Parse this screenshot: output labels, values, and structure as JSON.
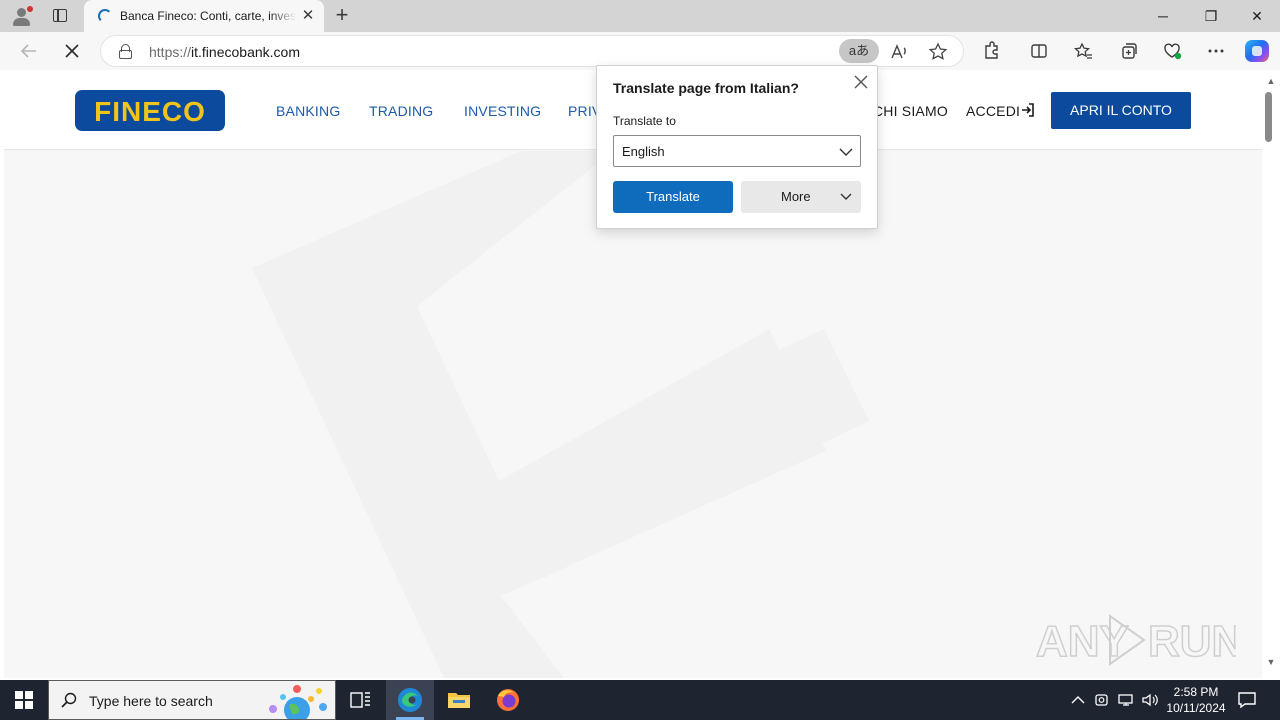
{
  "browser": {
    "tab_title": "Banca Fineco: Conti, carte, investimenti",
    "tab_close": "✕",
    "new_tab": "+",
    "url_scheme": "https://",
    "url_host": "it.finecobank.com",
    "translate_pill": "aあ",
    "window_controls": {
      "minimize": "─",
      "maximize": "❐",
      "close": "✕"
    }
  },
  "site": {
    "logo": "FINECO",
    "nav": [
      "BANKING",
      "TRADING",
      "INVESTING",
      "PRIV",
      "CHI SIAMO"
    ],
    "login": "ACCEDI",
    "cta": "APRI IL CONTO"
  },
  "translate_popup": {
    "title": "Translate page from Italian?",
    "label": "Translate to",
    "selected_language": "English",
    "translate_button": "Translate",
    "more_button": "More"
  },
  "taskbar": {
    "search_placeholder": "Type here to search",
    "time": "2:58 PM",
    "date": "10/11/2024"
  },
  "watermark": "ANY RUN",
  "colors": {
    "fineco_blue": "#0b4a9c",
    "fineco_yellow": "#f2c31b",
    "edge_accent": "#0f6cbd",
    "taskbar": "#1f2431"
  }
}
